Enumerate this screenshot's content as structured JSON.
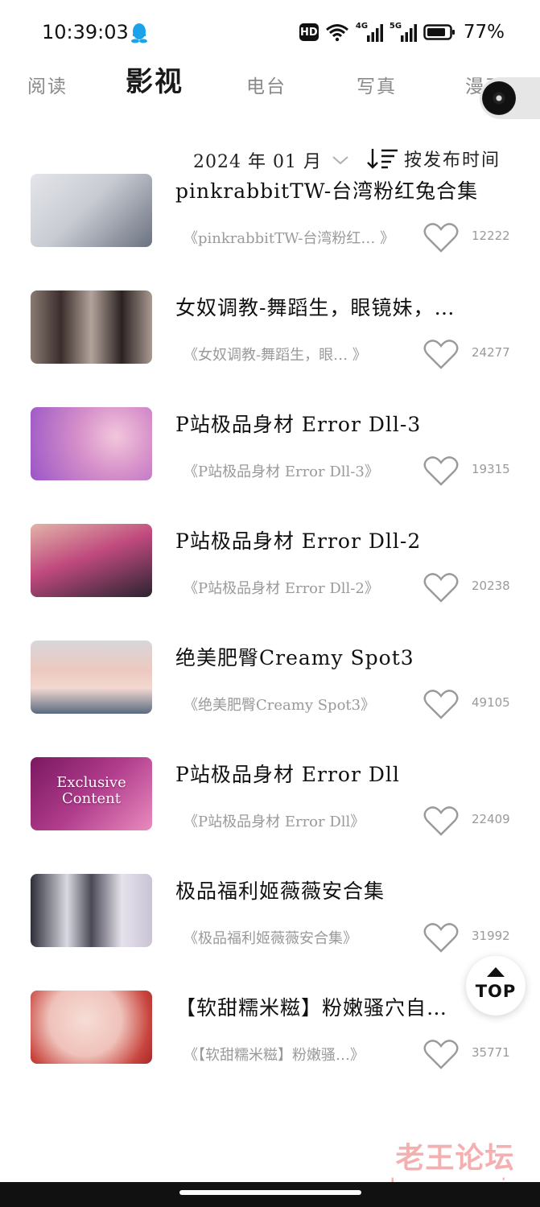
{
  "status_bar": {
    "time": "10:39:03",
    "hd_label": "HD",
    "net1": "4G",
    "net2": "5G",
    "battery": "77%",
    "icons": [
      "qq-penguin-icon",
      "hd-icon",
      "wifi-icon",
      "signal-4g-icon",
      "signal-5g-icon",
      "battery-icon"
    ]
  },
  "tabs": [
    {
      "label": "阅读",
      "active": false
    },
    {
      "label": "影视",
      "active": true
    },
    {
      "label": "电台",
      "active": false
    },
    {
      "label": "写真",
      "active": false
    },
    {
      "label": "漫画",
      "active": false
    }
  ],
  "filter": {
    "date_label": "2024 年 01 月",
    "sort_label": "按发布时间"
  },
  "items": [
    {
      "title": "pinkrabbitTW-台湾粉红兔合集",
      "subtitle": "《pinkrabbitTW-台湾粉红… 》",
      "count": "12222",
      "thumb_colors": [
        "#d9dbe0",
        "#6b7280"
      ]
    },
    {
      "title": "女奴调教-舞蹈生，眼镜妹，…",
      "subtitle": "《女奴调教-舞蹈生，眼… 》",
      "count": "24277",
      "thumb_colors": [
        "#a08f88",
        "#2b2322"
      ]
    },
    {
      "title": "P站极品身材 Error Dll-3",
      "subtitle": "《P站极品身材 Error Dll-3》",
      "count": "19315",
      "thumb_colors": [
        "#b06bd0",
        "#e9b6d8"
      ]
    },
    {
      "title": "P站极品身材 Error Dll-2",
      "subtitle": "《P站极品身材 Error Dll-2》",
      "count": "20238",
      "thumb_colors": [
        "#c0407a",
        "#2a2430"
      ]
    },
    {
      "title": "绝美肥臀Creamy Spot3",
      "subtitle": "《绝美肥臀Creamy Spot3》",
      "count": "49105",
      "thumb_colors": [
        "#e8c8c0",
        "#9a9aa8"
      ]
    },
    {
      "title": "P站极品身材 Error Dll",
      "subtitle": "《P站极品身材 Error Dll》",
      "count": "22409",
      "thumb_colors": [
        "#8e1f6d",
        "#e86fa8"
      ],
      "thumb_text": "Exclusive Content"
    },
    {
      "title": "极品福利姬薇薇安合集",
      "subtitle": "《极品福利姬薇薇安合集》",
      "count": "31992",
      "thumb_colors": [
        "#3a3a44",
        "#d9d9e0"
      ]
    },
    {
      "title": "【软甜糯米糍】粉嫩骚穴自…",
      "subtitle": "《【软甜糯米糍】粉嫩骚…》",
      "count": "35771",
      "thumb_colors": [
        "#f2d6d0",
        "#c43a3a"
      ]
    }
  ],
  "top_button": {
    "label": "TOP"
  },
  "watermark": {
    "cn": "老王论坛",
    "en": "laowang.vip"
  }
}
